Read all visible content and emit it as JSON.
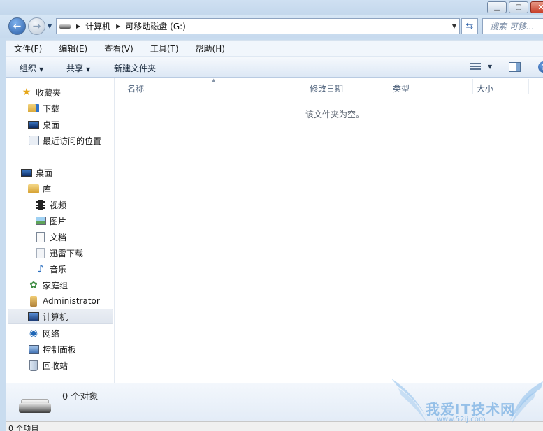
{
  "address": {
    "crumbs": [
      "计算机",
      "可移动磁盘 (G:)"
    ],
    "search_placeholder": "搜索 可移..."
  },
  "menu": [
    "文件(F)",
    "编辑(E)",
    "查看(V)",
    "工具(T)",
    "帮助(H)"
  ],
  "commands": {
    "organize": "组织",
    "share": "共享",
    "new_folder": "新建文件夹"
  },
  "nav": {
    "favorites": "收藏夹",
    "downloads": "下载",
    "desktop_fav": "桌面",
    "recent": "最近访问的位置",
    "desktop": "桌面",
    "libraries": "库",
    "videos": "视频",
    "pictures": "图片",
    "documents": "文档",
    "thunder": "迅雷下载",
    "music": "音乐",
    "homegroup": "家庭组",
    "admin": "Administrator",
    "computer": "计算机",
    "network": "网络",
    "control_panel": "控制面板",
    "recycle_bin": "回收站"
  },
  "columns": [
    "名称",
    "修改日期",
    "类型",
    "大小"
  ],
  "empty_message": "该文件夹为空。",
  "details_count": "0 个对象",
  "status": "0 个项目",
  "watermark": {
    "text": "我爱IT技术网",
    "url": "www.52ij.com"
  },
  "icons": {
    "back": "back-arrow-icon",
    "forward": "forward-arrow-icon",
    "refresh": "refresh-icon",
    "help": "help-icon"
  }
}
